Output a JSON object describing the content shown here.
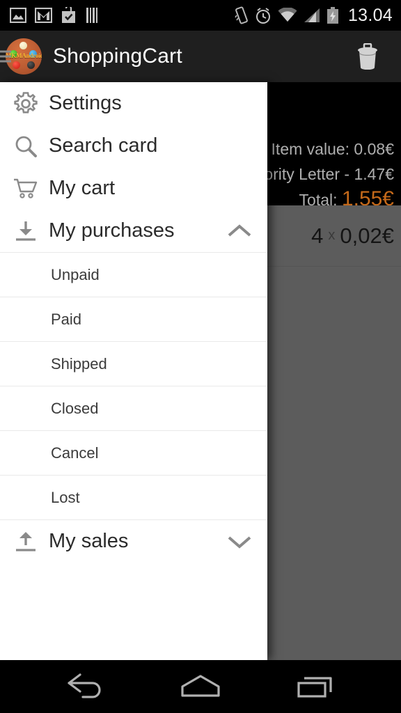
{
  "status_bar": {
    "time": "13.04",
    "left_icons": [
      "photo-icon",
      "gmail-icon",
      "play-store-bag-icon",
      "barcode-icon"
    ],
    "right_icons": [
      "vibrate-icon",
      "alarm-clock-icon",
      "wifi-icon",
      "cellular-signal-icon",
      "battery-charging-icon"
    ]
  },
  "app_bar": {
    "title": "ShoppingCart",
    "icon_label": "MKMAndroid",
    "delete_icon": "trash-icon",
    "menu_icon": "hamburger-icon"
  },
  "drawer": {
    "items": [
      {
        "label": "Settings",
        "icon": "gear-icon",
        "expandable": false
      },
      {
        "label": "Search card",
        "icon": "search-icon",
        "expandable": false
      },
      {
        "label": "My cart",
        "icon": "cart-icon",
        "expandable": false
      },
      {
        "label": "My purchases",
        "icon": "download-icon",
        "expandable": true,
        "expanded": true,
        "chevron": "chevron-up-icon"
      },
      {
        "label": "My sales",
        "icon": "upload-icon",
        "expandable": true,
        "expanded": false,
        "chevron": "chevron-down-icon"
      }
    ],
    "purchases_submenu": [
      "Unpaid",
      "Paid",
      "Shipped",
      "Closed",
      "Cancel",
      "Lost"
    ]
  },
  "content": {
    "summary": {
      "item_value": "Item value: 0.08€",
      "shipping": "ority Letter - 1.47€",
      "total_label": "Total: ",
      "total_value": "1.55€",
      "total_color": "#c4691a"
    },
    "rows": [
      {
        "qty": "4",
        "separator": "x",
        "price": "0,02€"
      }
    ]
  },
  "nav_bar": {
    "back": "back-icon",
    "home": "home-icon",
    "recents": "recents-icon"
  }
}
